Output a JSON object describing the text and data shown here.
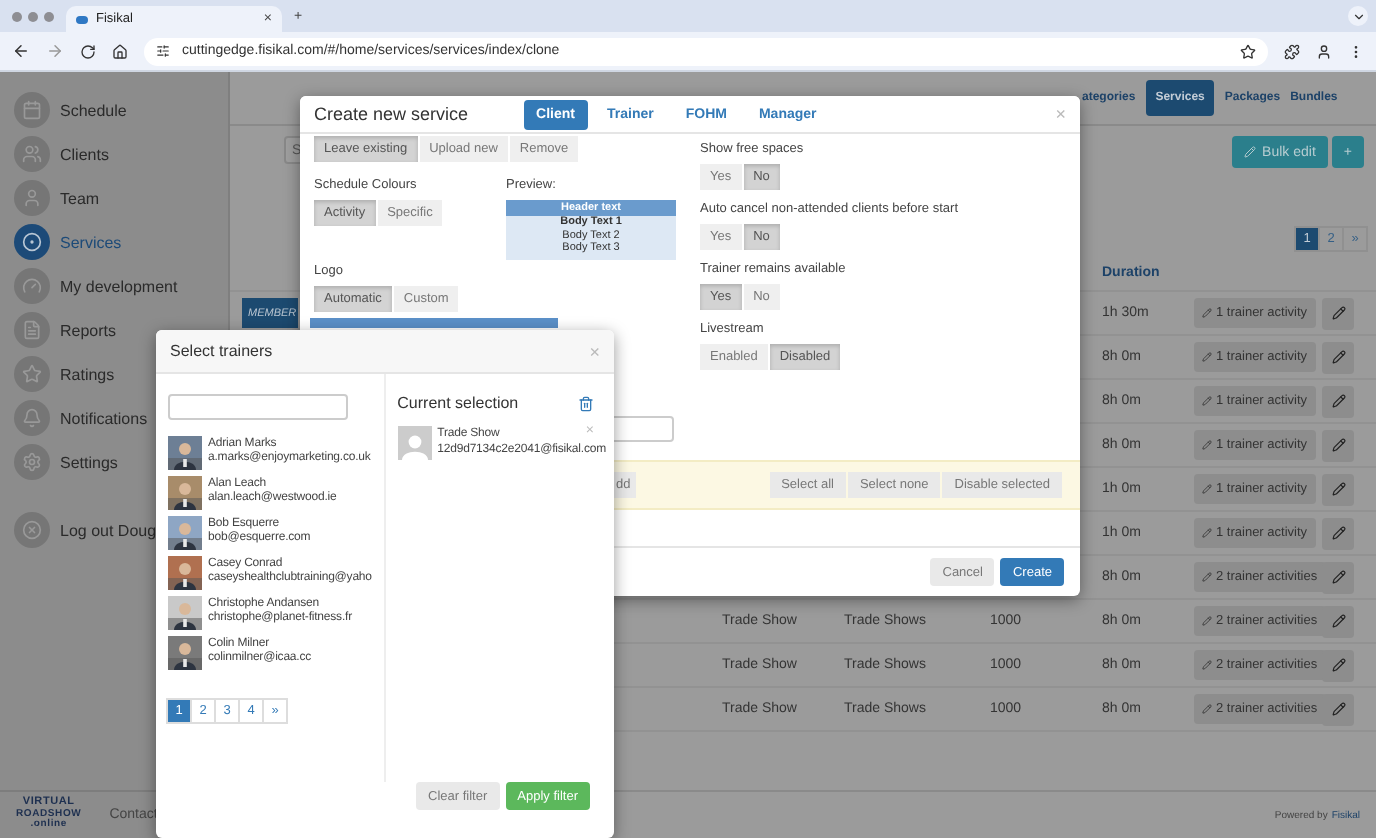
{
  "browser": {
    "tab_title": "Fisikal",
    "tab_close": "×",
    "new_tab": "+",
    "url": "cuttingedge.fisikal.com/#/home/services/services/index/clone"
  },
  "sidebar": {
    "items": [
      {
        "label": "Schedule",
        "selected": false
      },
      {
        "label": "Clients",
        "selected": false
      },
      {
        "label": "Team",
        "selected": false
      },
      {
        "label": "Services",
        "selected": true
      },
      {
        "label": "My development",
        "selected": false
      },
      {
        "label": "Reports",
        "selected": false
      },
      {
        "label": "Ratings",
        "selected": false
      },
      {
        "label": "Notifications",
        "selected": false
      },
      {
        "label": "Settings",
        "selected": false
      }
    ],
    "logout": "Log out Doug",
    "logo": [
      "VIRTUAL",
      "ROADSHOW",
      ".online"
    ],
    "contact": "Contact"
  },
  "nav": {
    "tabs": [
      {
        "label": "ategories",
        "selected": false
      },
      {
        "label": "Services",
        "selected": true
      },
      {
        "label": "Packages",
        "selected": false
      },
      {
        "label": "Bundles",
        "selected": false
      }
    ]
  },
  "toolbar": {
    "search_placeholder": "S",
    "bulk_edit": "Bulk edit",
    "add": "+"
  },
  "pagination": [
    {
      "label": "1",
      "selected": true
    },
    {
      "label": "2",
      "selected": false
    },
    {
      "label": "»",
      "selected": false
    }
  ],
  "table": {
    "duration_header": "Duration",
    "rows": [
      {
        "tag": "MEMBER",
        "duration": "1h 30m",
        "activities": "1 trainer activity"
      },
      {
        "duration": "8h 0m",
        "activities": "1 trainer activity"
      },
      {
        "duration": "8h 0m",
        "activities": "1 trainer activity"
      },
      {
        "duration": "8h 0m",
        "activities": "1 trainer activity"
      },
      {
        "duration": "1h 0m",
        "activities": "1 trainer activity"
      },
      {
        "duration": "1h 0m",
        "activities": "1 trainer activity"
      },
      {
        "duration": "8h 0m",
        "activities": "2 trainer activities"
      },
      {
        "name": "Trade Show",
        "category": "Trade Shows",
        "number": "1000",
        "duration": "8h 0m",
        "activities": "2 trainer activities"
      },
      {
        "name": "Trade Show",
        "category": "Trade Shows",
        "number": "1000",
        "duration": "8h 0m",
        "activities": "2 trainer activities"
      },
      {
        "name": "Trade Show",
        "category": "Trade Shows",
        "number": "1000",
        "duration": "8h 0m",
        "activities": "2 trainer activities"
      }
    ]
  },
  "footer": {
    "powered_by": "Powered by",
    "brand": "Fisikal"
  },
  "create_modal": {
    "title": "Create new service",
    "close": "×",
    "tabs": [
      {
        "label": "Client",
        "selected": true
      },
      {
        "label": "Trainer",
        "selected": false
      },
      {
        "label": "FOHM",
        "selected": false
      },
      {
        "label": "Manager",
        "selected": false
      }
    ],
    "logo_upload": [
      {
        "label": "Leave existing",
        "selected": true
      },
      {
        "label": "Upload new",
        "selected": false
      },
      {
        "label": "Remove",
        "selected": false
      }
    ],
    "schedule_colours": {
      "label": "Schedule Colours",
      "options": [
        {
          "label": "Activity",
          "selected": true
        },
        {
          "label": "Specific",
          "selected": false
        }
      ]
    },
    "preview": {
      "label": "Preview:",
      "header": "Header text",
      "lines": [
        "Body Text 1",
        "Body Text 2",
        "Body Text 3"
      ]
    },
    "logo": {
      "label": "Logo",
      "options": [
        {
          "label": "Automatic",
          "selected": true
        },
        {
          "label": "Custom",
          "selected": false
        }
      ]
    },
    "settings": [
      {
        "label": "Show free spaces",
        "options": [
          {
            "label": "Yes",
            "selected": false
          },
          {
            "label": "No",
            "selected": true
          }
        ]
      },
      {
        "label": "Auto cancel non-attended clients before start",
        "options": [
          {
            "label": "Yes",
            "selected": false
          },
          {
            "label": "No",
            "selected": true
          }
        ]
      },
      {
        "label": "Trainer remains available",
        "options": [
          {
            "label": "Yes",
            "selected": true
          },
          {
            "label": "No",
            "selected": false
          }
        ]
      },
      {
        "label": "Livestream",
        "options": [
          {
            "label": "Enabled",
            "selected": false
          },
          {
            "label": "Disabled",
            "selected": true
          }
        ]
      }
    ],
    "add_button": "dd",
    "bulk_actions": [
      "Select all",
      "Select none",
      "Disable selected"
    ],
    "buttons": [
      {
        "label": "Cancel",
        "kind": "secondary"
      },
      {
        "label": "Create",
        "kind": "primary"
      }
    ]
  },
  "select_trainers": {
    "title": "Select trainers",
    "close": "×",
    "trainers": [
      {
        "name": "Adrian Marks",
        "email": "a.marks@enjoymarketing.co.uk"
      },
      {
        "name": "Alan Leach",
        "email": "alan.leach@westwood.ie"
      },
      {
        "name": "Bob Esquerre",
        "email": "bob@esquerre.com"
      },
      {
        "name": "Casey Conrad",
        "email": "caseyshealthclubtraining@yaho"
      },
      {
        "name": "Christophe Andansen",
        "email": "christophe@planet-fitness.fr"
      },
      {
        "name": "Colin Milner",
        "email": "colinmilner@icaa.cc"
      }
    ],
    "pages": [
      {
        "label": "1",
        "selected": true
      },
      {
        "label": "2",
        "selected": false
      },
      {
        "label": "3",
        "selected": false
      },
      {
        "label": "4",
        "selected": false
      },
      {
        "label": "»",
        "selected": false
      }
    ],
    "selection": {
      "title": "Current selection",
      "items": [
        {
          "name": "Trade Show",
          "email": "12d9d7134c2e2041@fisikal.com",
          "remove": "×"
        }
      ]
    },
    "buttons": [
      {
        "label": "Clear filter",
        "kind": "secondary"
      },
      {
        "label": "Apply filter",
        "kind": "success"
      }
    ]
  }
}
